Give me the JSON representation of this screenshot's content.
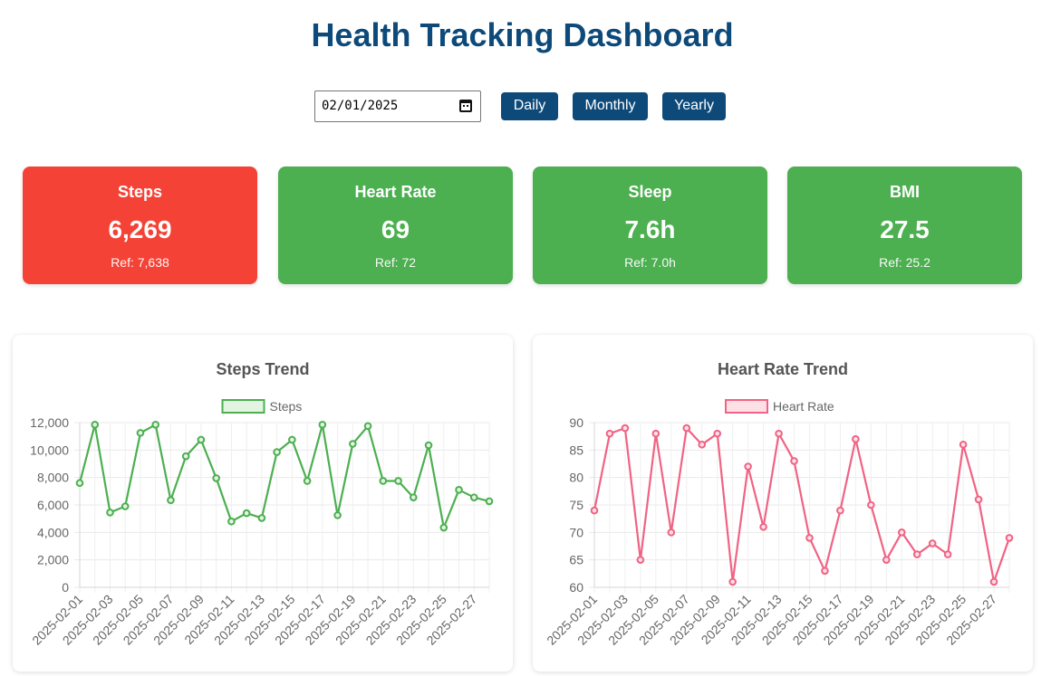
{
  "page": {
    "title": "Health Tracking Dashboard"
  },
  "controls": {
    "date_value": "02/01/2025",
    "buttons": {
      "daily": "Daily",
      "monthly": "Monthly",
      "yearly": "Yearly"
    }
  },
  "cards": [
    {
      "label": "Steps",
      "value": "6,269",
      "ref": "Ref: 7,638",
      "color": "#f44336"
    },
    {
      "label": "Heart Rate",
      "value": "69",
      "ref": "Ref: 72",
      "color": "#4caf50"
    },
    {
      "label": "Sleep",
      "value": "7.6h",
      "ref": "Ref: 7.0h",
      "color": "#4caf50"
    },
    {
      "label": "BMI",
      "value": "27.5",
      "ref": "Ref: 25.2",
      "color": "#4caf50"
    }
  ],
  "chart_data": [
    {
      "type": "line",
      "title": "Steps Trend",
      "legend": "top",
      "grid": true,
      "color": "#4caf50",
      "fill": "#e3f4e3",
      "x": [
        "2025-02-01",
        "2025-02-02",
        "2025-02-03",
        "2025-02-04",
        "2025-02-05",
        "2025-02-06",
        "2025-02-07",
        "2025-02-08",
        "2025-02-09",
        "2025-02-10",
        "2025-02-11",
        "2025-02-12",
        "2025-02-13",
        "2025-02-14",
        "2025-02-15",
        "2025-02-16",
        "2025-02-17",
        "2025-02-18",
        "2025-02-19",
        "2025-02-20",
        "2025-02-21",
        "2025-02-22",
        "2025-02-23",
        "2025-02-24",
        "2025-02-25",
        "2025-02-26",
        "2025-02-27",
        "2025-02-28"
      ],
      "x_tick_labels": [
        "2025-02-01",
        "2025-02-03",
        "2025-02-05",
        "2025-02-07",
        "2025-02-09",
        "2025-02-11",
        "2025-02-13",
        "2025-02-15",
        "2025-02-17",
        "2025-02-19",
        "2025-02-21",
        "2025-02-23",
        "2025-02-25",
        "2025-02-27"
      ],
      "series": [
        {
          "name": "Steps",
          "values": [
            7600,
            11850,
            5450,
            5900,
            11250,
            11850,
            6350,
            9550,
            10750,
            7950,
            4800,
            5400,
            5050,
            9850,
            10750,
            7750,
            11850,
            5250,
            10450,
            11750,
            7750,
            7750,
            6550,
            10350,
            4350,
            7100,
            6550,
            6269
          ]
        }
      ],
      "ylim": [
        0,
        12000
      ],
      "y_ticks": [
        0,
        2000,
        4000,
        6000,
        8000,
        10000,
        12000
      ],
      "y_tick_labels": [
        "0",
        "2,000",
        "4,000",
        "6,000",
        "8,000",
        "10,000",
        "12,000"
      ]
    },
    {
      "type": "line",
      "title": "Heart Rate Trend",
      "legend": "top",
      "grid": true,
      "color": "#f06384",
      "fill": "#fde0e6",
      "x": [
        "2025-02-01",
        "2025-02-02",
        "2025-02-03",
        "2025-02-04",
        "2025-02-05",
        "2025-02-06",
        "2025-02-07",
        "2025-02-08",
        "2025-02-09",
        "2025-02-10",
        "2025-02-11",
        "2025-02-12",
        "2025-02-13",
        "2025-02-14",
        "2025-02-15",
        "2025-02-16",
        "2025-02-17",
        "2025-02-18",
        "2025-02-19",
        "2025-02-20",
        "2025-02-21",
        "2025-02-22",
        "2025-02-23",
        "2025-02-24",
        "2025-02-25",
        "2025-02-26",
        "2025-02-27",
        "2025-02-28"
      ],
      "x_tick_labels": [
        "2025-02-01",
        "2025-02-03",
        "2025-02-05",
        "2025-02-07",
        "2025-02-09",
        "2025-02-11",
        "2025-02-13",
        "2025-02-15",
        "2025-02-17",
        "2025-02-19",
        "2025-02-21",
        "2025-02-23",
        "2025-02-25",
        "2025-02-27"
      ],
      "series": [
        {
          "name": "Heart Rate",
          "values": [
            74,
            88,
            89,
            65,
            88,
            70,
            89,
            86,
            88,
            61,
            82,
            71,
            88,
            83,
            69,
            63,
            74,
            87,
            75,
            65,
            70,
            66,
            68,
            66,
            86,
            76,
            61,
            69
          ]
        }
      ],
      "ylim": [
        60,
        90
      ],
      "y_ticks": [
        60,
        65,
        70,
        75,
        80,
        85,
        90
      ],
      "y_tick_labels": [
        "60",
        "65",
        "70",
        "75",
        "80",
        "85",
        "90"
      ]
    }
  ]
}
